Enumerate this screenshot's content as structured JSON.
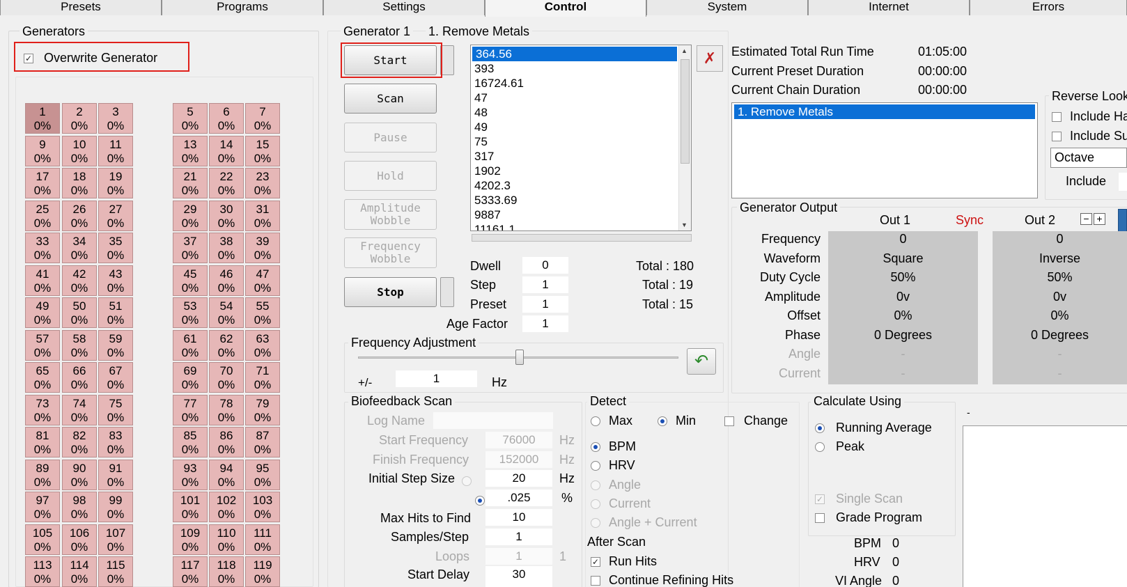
{
  "tabs": [
    "Presets",
    "Programs",
    "Settings",
    "Control",
    "System",
    "Internet",
    "Errors"
  ],
  "active_tab": "Control",
  "generators": {
    "title": "Generators",
    "overwrite_label": "Overwrite Generator",
    "overwrite_checked": true,
    "cells": [
      {
        "n": "1",
        "p": "0%"
      },
      {
        "n": "2",
        "p": "0%"
      },
      {
        "n": "3",
        "p": "0%"
      },
      {
        "n": "5",
        "p": "0%"
      },
      {
        "n": "6",
        "p": "0%"
      },
      {
        "n": "7",
        "p": "0%"
      },
      {
        "n": "9",
        "p": "0%"
      },
      {
        "n": "10",
        "p": "0%"
      },
      {
        "n": "11",
        "p": "0%"
      },
      {
        "n": "13",
        "p": "0%"
      },
      {
        "n": "14",
        "p": "0%"
      },
      {
        "n": "15",
        "p": "0%"
      },
      {
        "n": "17",
        "p": "0%"
      },
      {
        "n": "18",
        "p": "0%"
      },
      {
        "n": "19",
        "p": "0%"
      },
      {
        "n": "21",
        "p": "0%"
      },
      {
        "n": "22",
        "p": "0%"
      },
      {
        "n": "23",
        "p": "0%"
      },
      {
        "n": "25",
        "p": "0%"
      },
      {
        "n": "26",
        "p": "0%"
      },
      {
        "n": "27",
        "p": "0%"
      },
      {
        "n": "29",
        "p": "0%"
      },
      {
        "n": "30",
        "p": "0%"
      },
      {
        "n": "31",
        "p": "0%"
      },
      {
        "n": "33",
        "p": "0%"
      },
      {
        "n": "34",
        "p": "0%"
      },
      {
        "n": "35",
        "p": "0%"
      },
      {
        "n": "37",
        "p": "0%"
      },
      {
        "n": "38",
        "p": "0%"
      },
      {
        "n": "39",
        "p": "0%"
      },
      {
        "n": "41",
        "p": "0%"
      },
      {
        "n": "42",
        "p": "0%"
      },
      {
        "n": "43",
        "p": "0%"
      },
      {
        "n": "45",
        "p": "0%"
      },
      {
        "n": "46",
        "p": "0%"
      },
      {
        "n": "47",
        "p": "0%"
      },
      {
        "n": "49",
        "p": "0%"
      },
      {
        "n": "50",
        "p": "0%"
      },
      {
        "n": "51",
        "p": "0%"
      },
      {
        "n": "53",
        "p": "0%"
      },
      {
        "n": "54",
        "p": "0%"
      },
      {
        "n": "55",
        "p": "0%"
      },
      {
        "n": "57",
        "p": "0%"
      },
      {
        "n": "58",
        "p": "0%"
      },
      {
        "n": "59",
        "p": "0%"
      },
      {
        "n": "61",
        "p": "0%"
      },
      {
        "n": "62",
        "p": "0%"
      },
      {
        "n": "63",
        "p": "0%"
      },
      {
        "n": "65",
        "p": "0%"
      },
      {
        "n": "66",
        "p": "0%"
      },
      {
        "n": "67",
        "p": "0%"
      },
      {
        "n": "69",
        "p": "0%"
      },
      {
        "n": "70",
        "p": "0%"
      },
      {
        "n": "71",
        "p": "0%"
      },
      {
        "n": "73",
        "p": "0%"
      },
      {
        "n": "74",
        "p": "0%"
      },
      {
        "n": "75",
        "p": "0%"
      },
      {
        "n": "77",
        "p": "0%"
      },
      {
        "n": "78",
        "p": "0%"
      },
      {
        "n": "79",
        "p": "0%"
      },
      {
        "n": "81",
        "p": "0%"
      },
      {
        "n": "82",
        "p": "0%"
      },
      {
        "n": "83",
        "p": "0%"
      },
      {
        "n": "85",
        "p": "0%"
      },
      {
        "n": "86",
        "p": "0%"
      },
      {
        "n": "87",
        "p": "0%"
      },
      {
        "n": "89",
        "p": "0%"
      },
      {
        "n": "90",
        "p": "0%"
      },
      {
        "n": "91",
        "p": "0%"
      },
      {
        "n": "93",
        "p": "0%"
      },
      {
        "n": "94",
        "p": "0%"
      },
      {
        "n": "95",
        "p": "0%"
      },
      {
        "n": "97",
        "p": "0%"
      },
      {
        "n": "98",
        "p": "0%"
      },
      {
        "n": "99",
        "p": "0%"
      },
      {
        "n": "101",
        "p": "0%"
      },
      {
        "n": "102",
        "p": "0%"
      },
      {
        "n": "103",
        "p": "0%"
      },
      {
        "n": "105",
        "p": "0%"
      },
      {
        "n": "106",
        "p": "0%"
      },
      {
        "n": "107",
        "p": "0%"
      },
      {
        "n": "109",
        "p": "0%"
      },
      {
        "n": "110",
        "p": "0%"
      },
      {
        "n": "111",
        "p": "0%"
      },
      {
        "n": "113",
        "p": "0%"
      },
      {
        "n": "114",
        "p": "0%"
      },
      {
        "n": "115",
        "p": "0%"
      },
      {
        "n": "117",
        "p": "0%"
      },
      {
        "n": "118",
        "p": "0%"
      },
      {
        "n": "119",
        "p": "0%"
      }
    ]
  },
  "generator1": {
    "title": "Generator 1",
    "program": "1. Remove Metals",
    "buttons": {
      "start": "Start",
      "scan": "Scan",
      "pause": "Pause",
      "hold": "Hold",
      "amp1": "Amplitude",
      "amp2": "Wobble",
      "freq1": "Frequency",
      "freq2": "Wobble",
      "stop": "Stop"
    },
    "frequencies": [
      "364.56",
      "393",
      "16724.61",
      "47",
      "48",
      "49",
      "75",
      "317",
      "1902",
      "4202.3",
      "5333.69",
      "9887",
      "11161.1"
    ],
    "dwell": {
      "label": "Dwell",
      "value": "0",
      "total": "Total : 180"
    },
    "step": {
      "label": "Step",
      "value": "1",
      "total": "Total : 19"
    },
    "preset": {
      "label": "Preset",
      "value": "1",
      "total": "Total : 15"
    },
    "age": {
      "label": "Age Factor",
      "value": "1"
    }
  },
  "runinfo": {
    "est_label": "Estimated Total Run Time",
    "est_value": "01:05:00",
    "preset_label": "Current Preset Duration",
    "preset_value": "00:00:00",
    "chain_label": "Current Chain Duration",
    "chain_value": "00:00:00",
    "chain_items": [
      "1. Remove Metals"
    ]
  },
  "reverse": {
    "title": "Reverse Look",
    "inc1": "Include Ha",
    "inc2": "Include Su",
    "dropdown": "Octave",
    "include": "Include"
  },
  "output": {
    "title": "Generator Output",
    "out1": "Out 1",
    "sync": "Sync",
    "out2": "Out 2",
    "rows": [
      {
        "label": "Frequency",
        "o1": "0",
        "o2": "0",
        "dis": false
      },
      {
        "label": "Waveform",
        "o1": "Square",
        "o2": "Inverse",
        "dis": false
      },
      {
        "label": "Duty Cycle",
        "o1": "50%",
        "o2": "50%",
        "dis": false
      },
      {
        "label": "Amplitude",
        "o1": "0v",
        "o2": "0v",
        "dis": false
      },
      {
        "label": "Offset",
        "o1": "0%",
        "o2": "0%",
        "dis": false
      },
      {
        "label": "Phase",
        "o1": "0 Degrees",
        "o2": "0 Degrees",
        "dis": false
      },
      {
        "label": "Angle",
        "o1": "-",
        "o2": "-",
        "dis": true
      },
      {
        "label": "Current",
        "o1": "-",
        "o2": "-",
        "dis": true
      }
    ]
  },
  "freqadj": {
    "title": "Frequency Adjustment",
    "pm": "+/-",
    "value": "1",
    "unit": "Hz"
  },
  "bioscan": {
    "title": "Biofeedback Scan",
    "logname": "Log Name",
    "start_label": "Start Frequency",
    "start_value": "76000",
    "start_unit": "Hz",
    "finish_label": "Finish Frequency",
    "finish_value": "152000",
    "finish_unit": "Hz",
    "init_label": "Initial Step Size",
    "init_value": "20",
    "init_unit": "Hz",
    "pct_value": ".025",
    "pct_unit": "%",
    "maxhits_label": "Max Hits to Find",
    "maxhits_value": "10",
    "samples_label": "Samples/Step",
    "samples_value": "1",
    "loops_label": "Loops",
    "loops_value": "1",
    "loops_extra": "1",
    "delay_label": "Start Delay",
    "delay_value": "30"
  },
  "detect": {
    "title": "Detect",
    "max": "Max",
    "min": "Min",
    "change": "Change",
    "bpm": "BPM",
    "hrv": "HRV",
    "angle": "Angle",
    "current": "Current",
    "anglecurrent": "Angle + Current",
    "after": "After Scan",
    "runhits": "Run Hits",
    "refine": "Continue Refining Hits"
  },
  "calc": {
    "title": "Calculate Using",
    "running": "Running Average",
    "peak": "Peak",
    "single": "Single Scan",
    "grade": "Grade Program",
    "dash": "-",
    "bpm_label": "BPM",
    "bpm_value": "0",
    "hrv_label": "HRV",
    "hrv_value": "0",
    "vi_label": "VI Angle",
    "vi_value": "0"
  },
  "colors": {
    "cell": "#e6b7b7",
    "cell_selected": "#c79292",
    "highlight": "#0b6fd6",
    "sync": "#cc1111",
    "annotation": "#e0201a"
  }
}
